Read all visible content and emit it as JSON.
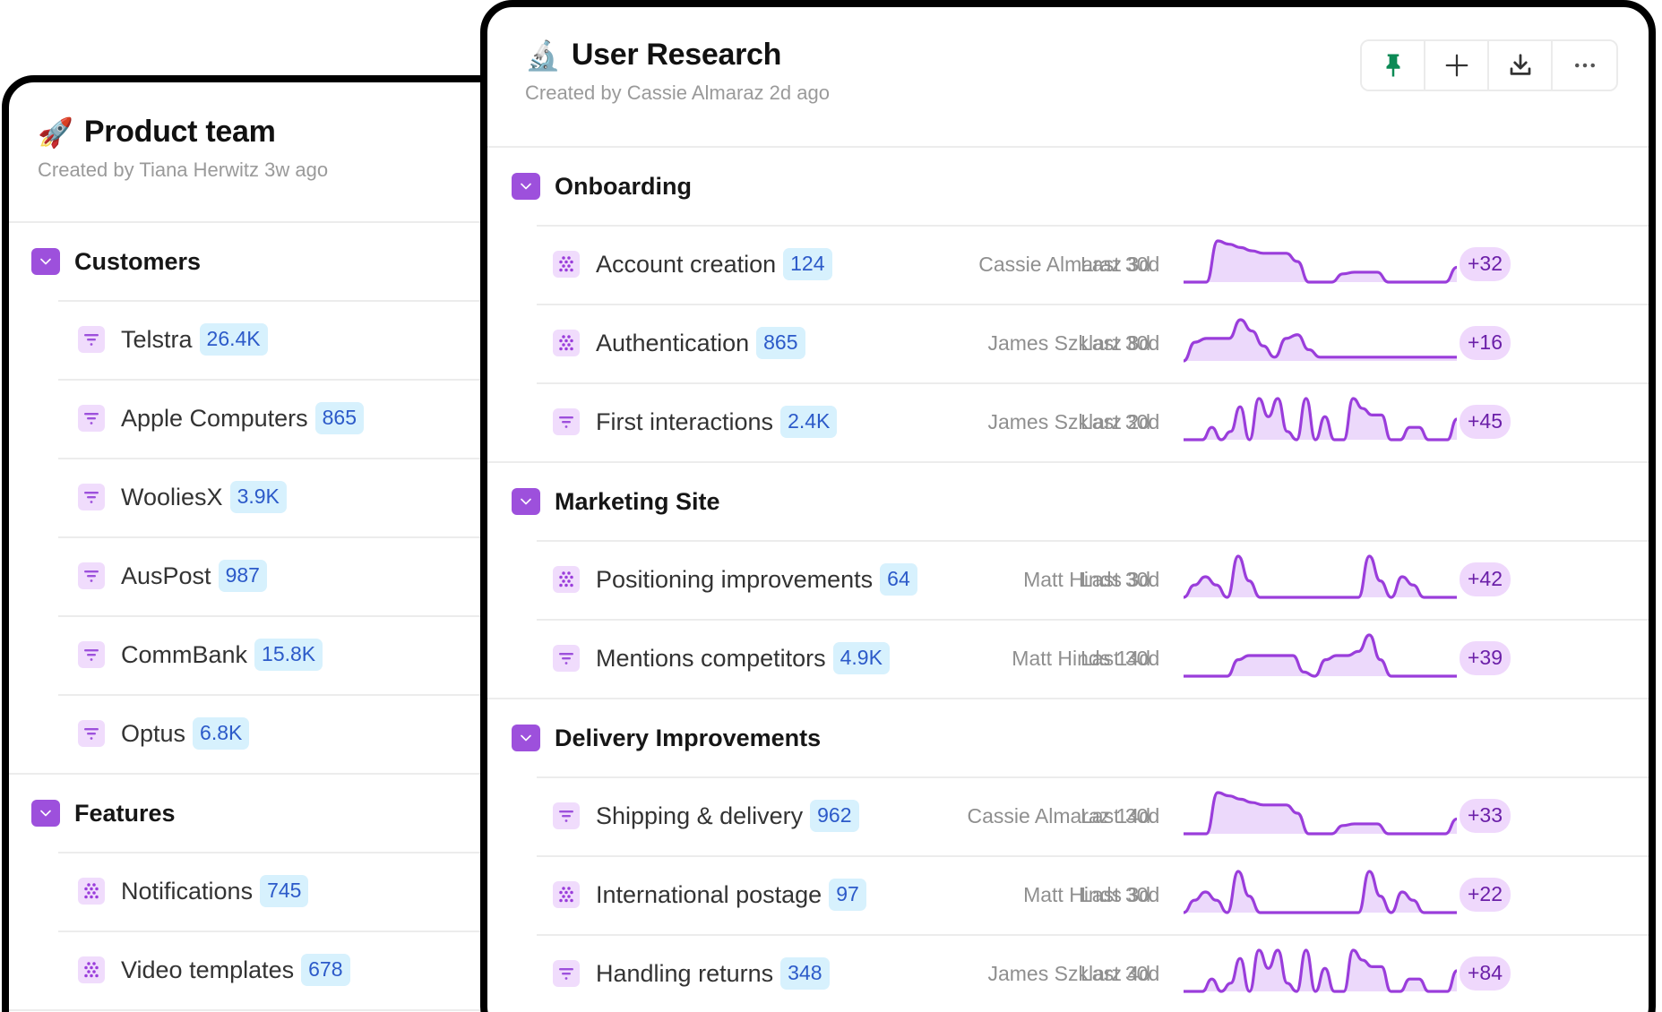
{
  "colors": {
    "accent_purple": "#9d50dc",
    "sparkline_stroke": "#9a3ddb",
    "sparkline_fill": "#ecd9fb",
    "count_badge_bg": "#d7f1fd",
    "count_badge_text": "#2c5ac9",
    "delta_badge_bg": "#efd8fc",
    "delta_badge_text": "#6b1fa8",
    "pin_green": "#0b8a55"
  },
  "left_panel": {
    "emoji": "🚀",
    "emoji_icon": "rocket-icon",
    "title": "Product team",
    "subtitle": "Created by Tiana Herwitz 3w ago",
    "sections": [
      {
        "title": "Customers",
        "items": [
          {
            "icon": "funnel-icon",
            "name": "Telstra",
            "count": "26.4K"
          },
          {
            "icon": "funnel-icon",
            "name": "Apple Computers",
            "count": "865"
          },
          {
            "icon": "funnel-icon",
            "name": "WooliesX",
            "count": "3.9K"
          },
          {
            "icon": "funnel-icon",
            "name": "AusPost",
            "count": "987"
          },
          {
            "icon": "funnel-icon",
            "name": "CommBank",
            "count": "15.8K"
          },
          {
            "icon": "funnel-icon",
            "name": "Optus",
            "count": "6.8K"
          }
        ]
      },
      {
        "title": "Features",
        "items": [
          {
            "icon": "dots-icon",
            "name": "Notifications",
            "count": "745"
          },
          {
            "icon": "dots-icon",
            "name": "Video templates",
            "count": "678"
          }
        ]
      }
    ]
  },
  "right_panel": {
    "emoji": "🔬",
    "emoji_icon": "microscope-icon",
    "title": "User Research",
    "subtitle": "Created by Cassie Almaraz 2d ago",
    "toolbar": [
      {
        "name": "pin-button",
        "icon": "pin-icon"
      },
      {
        "name": "add-button",
        "icon": "plus-icon"
      },
      {
        "name": "download-button",
        "icon": "download-icon"
      },
      {
        "name": "more-button",
        "icon": "more-icon"
      }
    ],
    "sections": [
      {
        "title": "Onboarding",
        "items": [
          {
            "icon": "dots-icon",
            "name": "Account creation",
            "count": "124",
            "author": "Cassie Almaraz 3d",
            "range": "Last 30d",
            "delta": "+32",
            "trend": [
              0,
              0,
              0,
              5,
              4.6,
              4.2,
              3.8,
              3.5,
              3.5,
              3.5,
              2.5,
              0,
              0,
              0,
              1,
              1.2,
              1.2,
              1.2,
              0,
              0,
              0,
              0,
              0,
              0,
              1.8
            ]
          },
          {
            "icon": "dots-icon",
            "name": "Authentication",
            "count": "865",
            "author": "James Szklarz 8d",
            "range": "Last 30d",
            "delta": "+16",
            "trend": [
              -0.5,
              2,
              2.5,
              2.5,
              2.5,
              5,
              3.5,
              1.5,
              0,
              2.5,
              3,
              1,
              0,
              0,
              0,
              0,
              0,
              0,
              0,
              0,
              0,
              0,
              0,
              0,
              0
            ]
          },
          {
            "icon": "funnel-icon",
            "name": "First interactions",
            "count": "2.4K",
            "author": "James Szklarz 2d",
            "range": "Last 30d",
            "delta": "+45",
            "trend": [
              0,
              0,
              0,
              1.5,
              0,
              1,
              4,
              0,
              5,
              2.8,
              5,
              1,
              0,
              5,
              0,
              2.8,
              0,
              0,
              5,
              3.8,
              3,
              3,
              0,
              0,
              1.5,
              1.5,
              0,
              0,
              0,
              2.5
            ]
          }
        ]
      },
      {
        "title": "Marketing Site",
        "items": [
          {
            "icon": "dots-icon",
            "name": "Positioning improvements",
            "count": "64",
            "author": "Matt Hinds 3d",
            "range": "Last 30d",
            "delta": "+42",
            "trend": [
              0,
              1.5,
              2.5,
              1.5,
              0,
              5,
              2,
              0,
              0,
              0,
              0,
              0,
              0,
              0,
              0,
              0,
              0,
              5,
              2,
              0,
              2.5,
              1.5,
              0,
              0,
              0,
              0
            ]
          },
          {
            "icon": "funnel-icon",
            "name": "Mentions competitors",
            "count": "4.9K",
            "author": "Matt Hinds 14d",
            "range": "Last 30d",
            "delta": "+39",
            "trend": [
              0,
              0,
              0,
              0,
              0,
              2,
              2.5,
              2.5,
              2.5,
              2.5,
              2.5,
              0.5,
              0,
              2,
              2.5,
              2.5,
              3,
              5,
              2,
              0,
              0,
              0,
              0,
              0,
              0,
              0
            ]
          }
        ]
      },
      {
        "title": "Delivery Improvements",
        "items": [
          {
            "icon": "funnel-icon",
            "name": "Shipping & delivery",
            "count": "962",
            "author": "Cassie Almaraz 14d",
            "range": "Last 30d",
            "delta": "+33",
            "trend": [
              0,
              0,
              0,
              5,
              4.6,
              4.2,
              3.8,
              3.5,
              3.5,
              3.5,
              2.5,
              0,
              0,
              0,
              1,
              1.2,
              1.2,
              1.2,
              0,
              0,
              0,
              0,
              0,
              0,
              1.8
            ]
          },
          {
            "icon": "dots-icon",
            "name": "International postage",
            "count": "97",
            "author": "Matt Hinds 3d",
            "range": "Last 30d",
            "delta": "+22",
            "trend": [
              0,
              1.5,
              2.5,
              1.5,
              0,
              5,
              2,
              0,
              0,
              0,
              0,
              0,
              0,
              0,
              0,
              0,
              0,
              5,
              2,
              0,
              2.5,
              1.5,
              0,
              0,
              0,
              0
            ]
          },
          {
            "icon": "funnel-icon",
            "name": "Handling returns",
            "count": "348",
            "author": "James Szklarz 4d",
            "range": "Last 30d",
            "delta": "+84",
            "trend": [
              0,
              0,
              0,
              1.5,
              0,
              1,
              4,
              0,
              5,
              2.8,
              5,
              1,
              0,
              5,
              0,
              2.8,
              0,
              0,
              5,
              3.8,
              3,
              3,
              0,
              0,
              1.5,
              1.5,
              0,
              0,
              0,
              2.5
            ]
          }
        ]
      }
    ]
  }
}
